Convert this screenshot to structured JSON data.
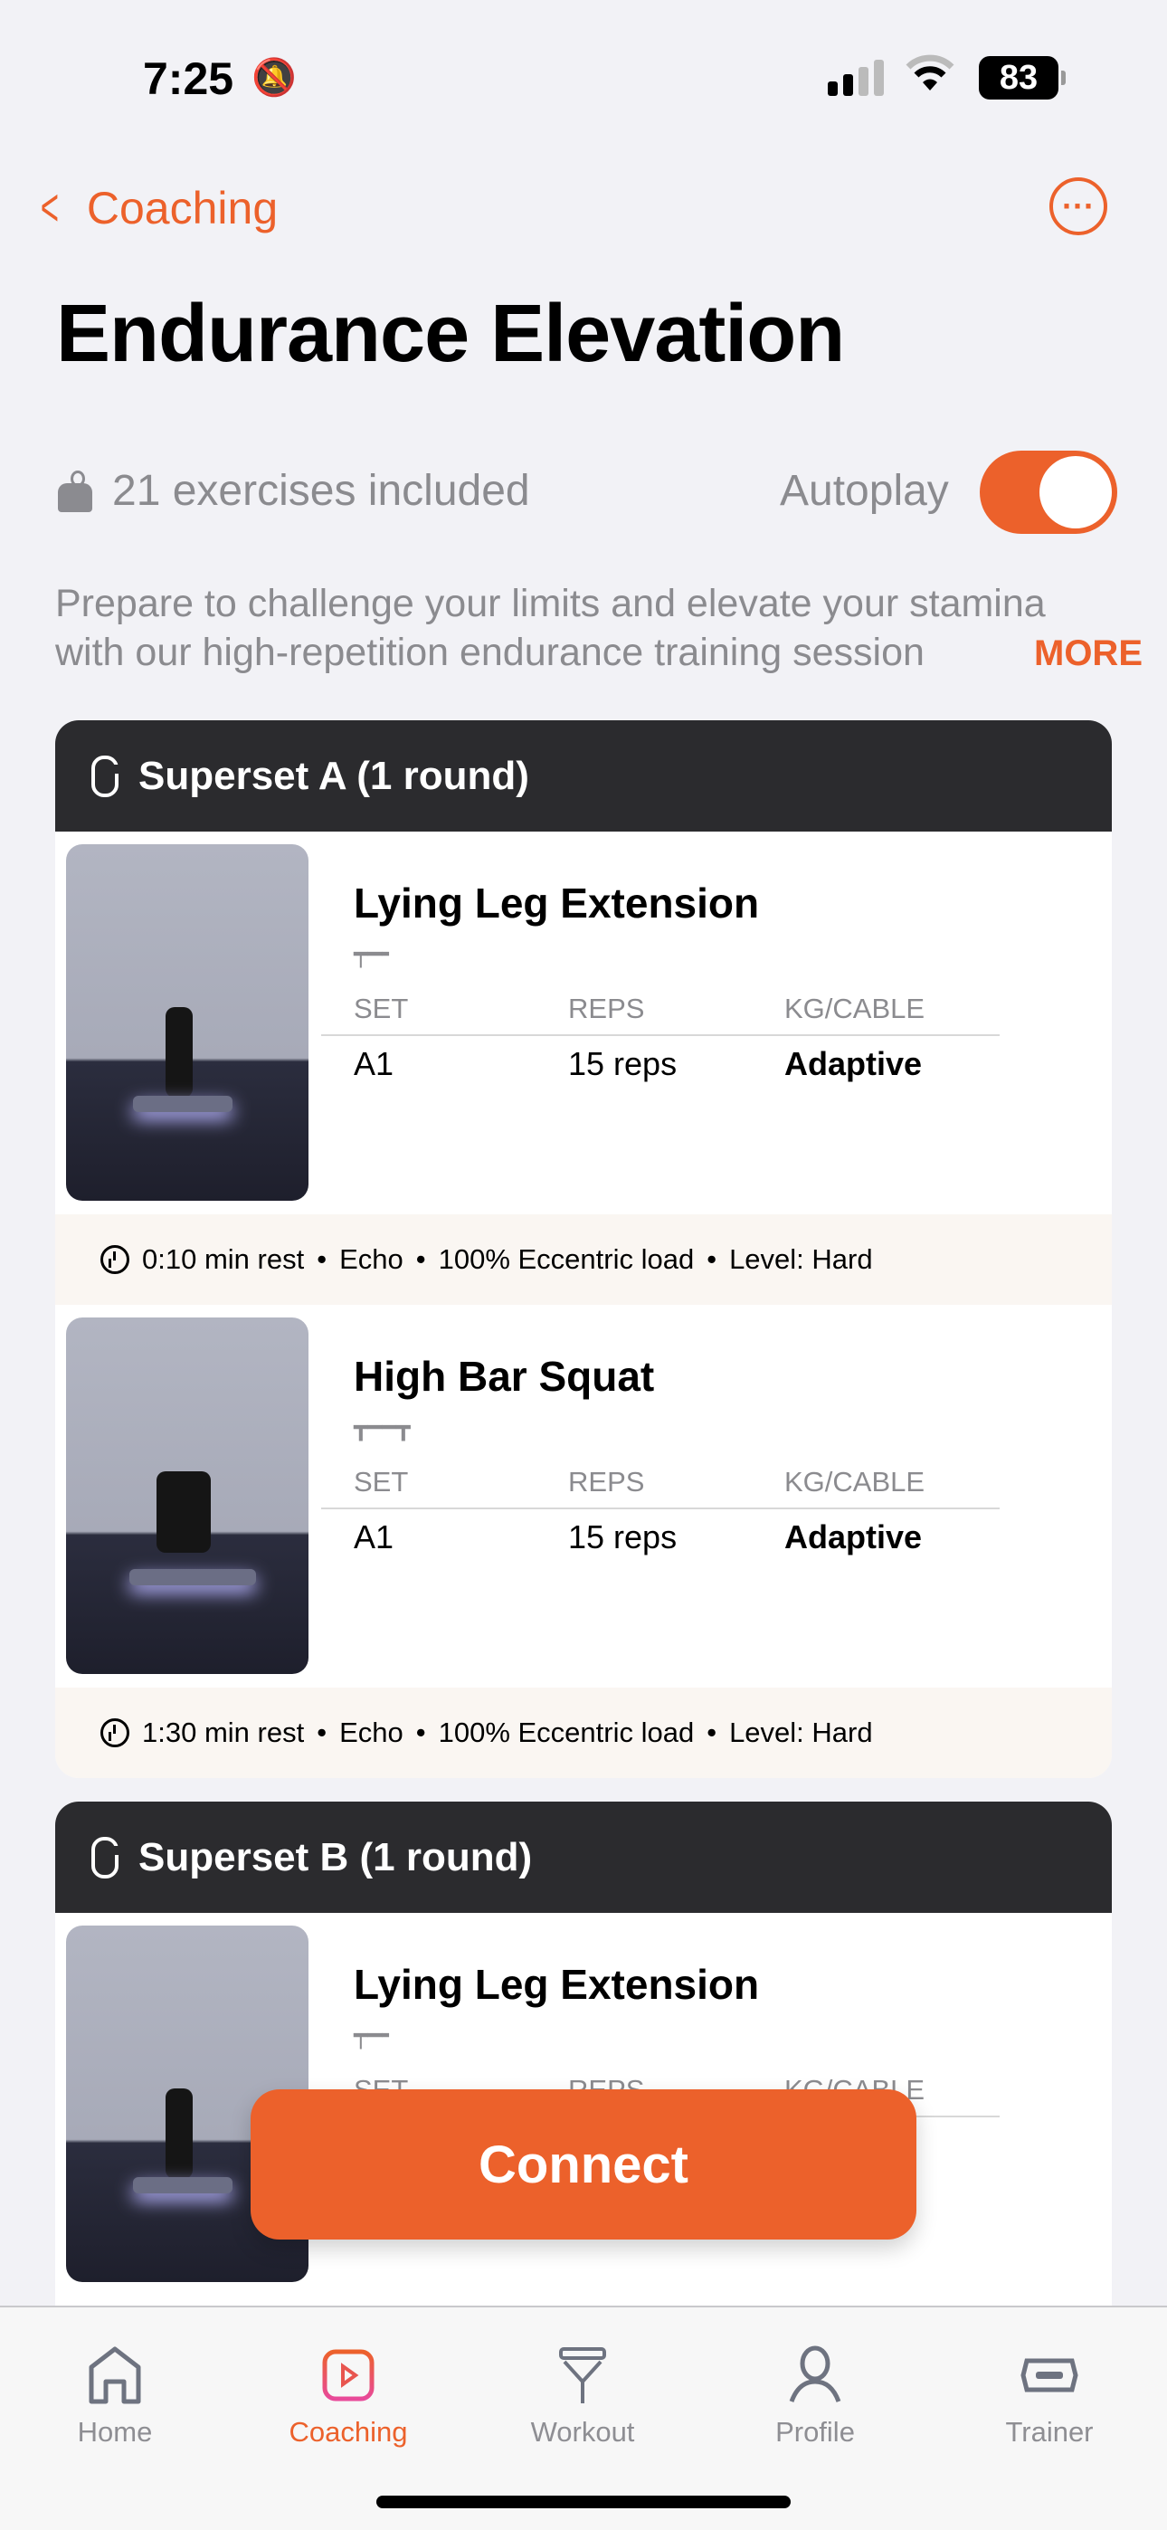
{
  "status_bar": {
    "time": "7:25",
    "battery": "83",
    "icons": [
      "bell-slash-icon",
      "cellular-signal-icon",
      "wifi-icon",
      "battery-icon"
    ]
  },
  "nav": {
    "back_label": "Coaching",
    "more_icon": "ellipsis-circle-icon"
  },
  "header": {
    "title": "Endurance Elevation",
    "exercise_count": "21 exercises included",
    "autoplay_label": "Autoplay",
    "autoplay_on": true,
    "description": "Prepare to challenge your limits and elevate your stamina with our high-repetition endurance training session",
    "more_label": "MORE"
  },
  "columns": {
    "set": "SET",
    "reps": "REPS",
    "load": "KG/CABLE"
  },
  "supersets": [
    {
      "title": "Superset A (1 round)",
      "exercises": [
        {
          "name": "Lying Leg Extension",
          "set": "A1",
          "reps": "15 reps",
          "load": "Adaptive",
          "rest": "0:10 min rest",
          "mode": "Echo",
          "eccentric": "100% Eccentric load",
          "level": "Level: Hard"
        },
        {
          "name": "High Bar Squat",
          "set": "A1",
          "reps": "15 reps",
          "load": "Adaptive",
          "rest": "1:30 min rest",
          "mode": "Echo",
          "eccentric": "100% Eccentric load",
          "level": "Level: Hard"
        }
      ]
    },
    {
      "title": "Superset B (1 round)",
      "exercises": [
        {
          "name": "Lying Leg Extension",
          "set": "",
          "reps": "",
          "load": ""
        }
      ]
    }
  ],
  "connect_label": "Connect",
  "tabs": [
    {
      "label": "Home",
      "icon": "house-icon"
    },
    {
      "label": "Coaching",
      "icon": "play-rectangle-icon",
      "active": true
    },
    {
      "label": "Workout",
      "icon": "cable-handle-icon"
    },
    {
      "label": "Profile",
      "icon": "person-icon"
    },
    {
      "label": "Trainer",
      "icon": "trainer-device-icon"
    }
  ],
  "colors": {
    "accent": "#ec612b",
    "header_dark": "#2b2b2e",
    "footer_bg": "#faf6f2"
  }
}
